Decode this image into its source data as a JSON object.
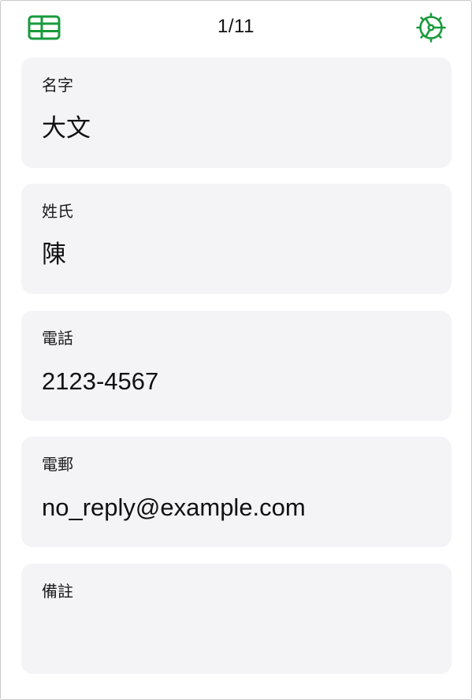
{
  "toolbar": {
    "left_icon": "table-grid-icon",
    "record_counter": "1/11",
    "right_icon": "gear-icon",
    "accent_color": "#1a9a3c"
  },
  "fields": [
    {
      "label": "名字",
      "value": "大文"
    },
    {
      "label": "姓氏",
      "value": "陳"
    },
    {
      "label": "電話",
      "value": "2123-4567"
    },
    {
      "label": "電郵",
      "value": "no_reply@example.com"
    },
    {
      "label": "備註",
      "value": ""
    }
  ],
  "colors": {
    "card_background": "#f4f4f7",
    "text": "#111111"
  }
}
